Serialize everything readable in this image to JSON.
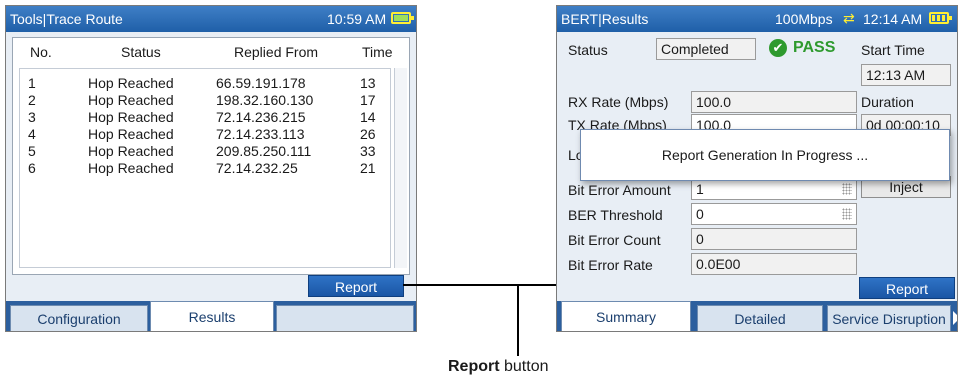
{
  "left_screen": {
    "title": "Tools|Trace Route",
    "clock": "10:59 AM",
    "columns": [
      "No.",
      "Status",
      "Replied From",
      "Time"
    ],
    "rows": [
      {
        "no": "1",
        "status": "Hop Reached",
        "from": "66.59.191.178",
        "time": "13"
      },
      {
        "no": "2",
        "status": "Hop Reached",
        "from": "198.32.160.130",
        "time": "17"
      },
      {
        "no": "3",
        "status": "Hop Reached",
        "from": "72.14.236.215",
        "time": "14"
      },
      {
        "no": "4",
        "status": "Hop Reached",
        "from": "72.14.233.113",
        "time": "26"
      },
      {
        "no": "5",
        "status": "Hop Reached",
        "from": "209.85.250.111",
        "time": "33"
      },
      {
        "no": "6",
        "status": "Hop Reached",
        "from": "72.14.232.25",
        "time": "21"
      }
    ],
    "report_label": "Report",
    "tabs": [
      "Configuration",
      "Results",
      ""
    ],
    "active_tab": "Results"
  },
  "right_screen": {
    "title": "BERT|Results",
    "rate": "100Mbps",
    "clock": "12:14 AM",
    "status_label": "Status",
    "status_value": "Completed",
    "verdict": "PASS",
    "start_time_label": "Start Time",
    "start_time_value": "12:13 AM",
    "rx_rate_label": "RX Rate (Mbps)",
    "rx_rate_value": "100.0",
    "tx_rate_label": "TX Rate (Mbps)",
    "tx_rate_value": "100.0",
    "duration_label": "Duration",
    "duration_value": "0d 00:00:10",
    "lo_label": "Lo",
    "bit_error_amount_label": "Bit Error Amount",
    "bit_error_amount_value": "1",
    "inject_label": "Inject",
    "ber_threshold_label": "BER Threshold",
    "ber_threshold_value": "0",
    "bit_error_count_label": "Bit Error Count",
    "bit_error_count_value": "0",
    "bit_error_rate_label": "Bit Error Rate",
    "bit_error_rate_value": "0.0E00",
    "dialog_text": "Report Generation In Progress ...",
    "report_label": "Report",
    "tabs": [
      "Summary",
      "Detailed",
      "Service Disruption"
    ],
    "active_tab": "Summary"
  },
  "callout": {
    "bold": "Report",
    "rest": " button"
  },
  "colors": {
    "title_bar": "#2b6cb8",
    "pass_green": "#2e9a2e",
    "battery": "#ffee33"
  },
  "icons": [
    "battery-icon",
    "transfer-arrows-icon",
    "pass-check-icon",
    "grip-icon",
    "scroll-right-arrow-icon"
  ]
}
